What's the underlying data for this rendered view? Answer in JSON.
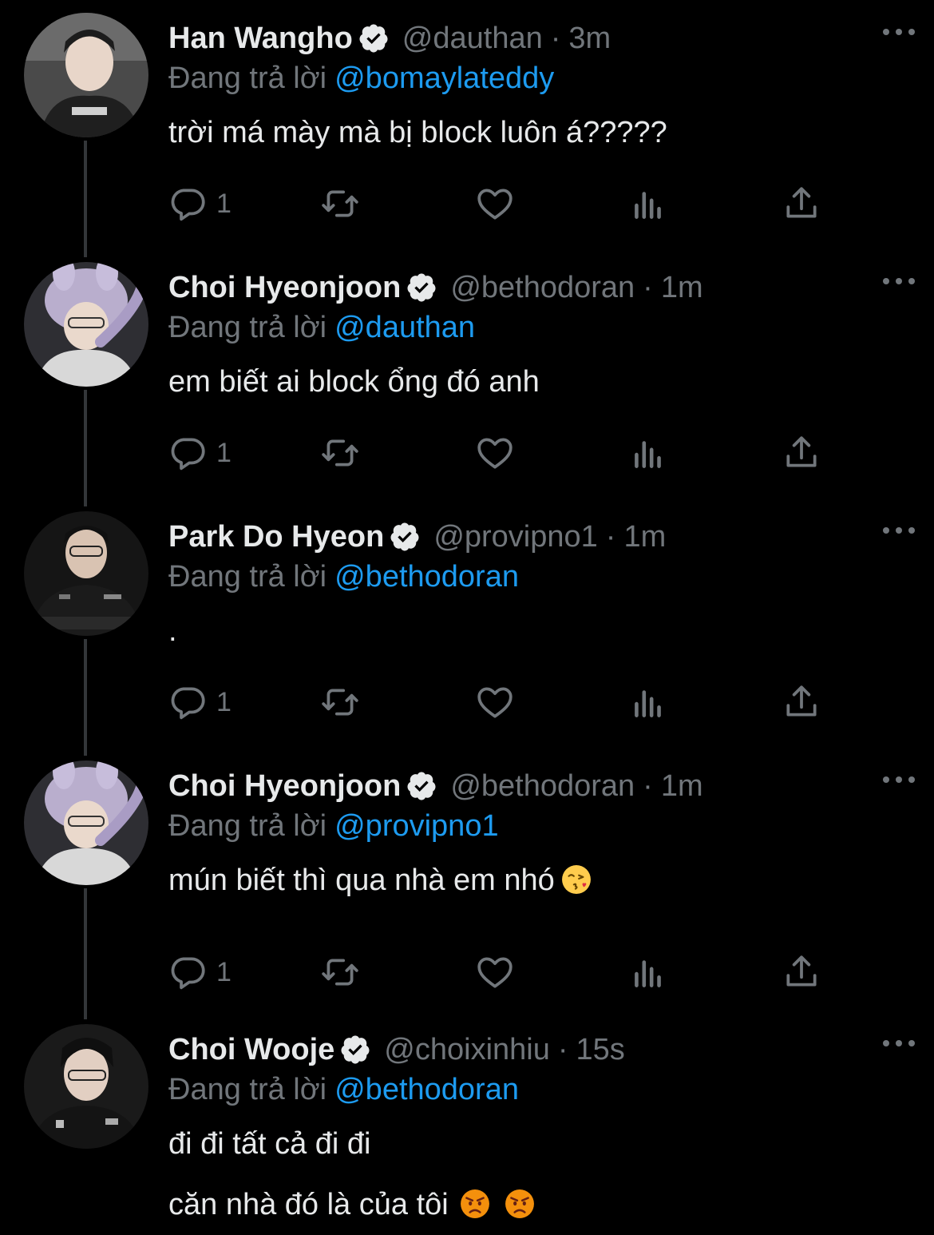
{
  "colors": {
    "background": "#000000",
    "primary_text": "#e7e9ea",
    "secondary_text": "#71767b",
    "link": "#1d9bf0",
    "thread_line": "#333639"
  },
  "reply_prefix": "Đang trả lời",
  "tweets": [
    {
      "display_name": "Han Wangho",
      "handle": "@dauthan",
      "separator": "·",
      "time": "3m",
      "reply_to": "@bomaylateddy",
      "lines": [
        "trời má mày mà bị block luôn á?????"
      ],
      "reply_count": "1",
      "avatar_icon": "avatar-photo"
    },
    {
      "display_name": "Choi Hyeonjoon",
      "handle": "@bethodoran",
      "separator": "·",
      "time": "1m",
      "reply_to": "@dauthan",
      "lines": [
        "em biết ai block ổng đó anh"
      ],
      "reply_count": "1",
      "avatar_icon": "avatar-photo"
    },
    {
      "display_name": "Park Do Hyeon",
      "handle": "@provipno1",
      "separator": "·",
      "time": "1m",
      "reply_to": "@bethodoran",
      "lines": [
        "."
      ],
      "reply_count": "1",
      "avatar_icon": "avatar-photo"
    },
    {
      "display_name": "Choi Hyeonjoon",
      "handle": "@bethodoran",
      "separator": "·",
      "time": "1m",
      "reply_to": "@provipno1",
      "lines": [
        "mún biết thì qua nhà em nhó"
      ],
      "reply_count": "1",
      "emoji": [
        "face-blowing-kiss-emoji"
      ],
      "avatar_icon": "avatar-photo"
    },
    {
      "display_name": "Choi Wooje",
      "handle": "@choixinhiu",
      "separator": "·",
      "time": "15s",
      "reply_to": "@bethodoran",
      "lines": [
        "đi đi tất cả đi đi",
        "căn nhà đó là của tôi"
      ],
      "emoji": [
        "angry-face-emoji",
        "angry-face-emoji"
      ],
      "avatar_icon": "avatar-photo"
    }
  ],
  "icons": {
    "verified": "verified-badge-icon",
    "more": "more-options-icon",
    "reply": "reply-icon",
    "retweet": "retweet-icon",
    "like": "like-icon",
    "views": "views-icon",
    "share": "share-icon"
  }
}
